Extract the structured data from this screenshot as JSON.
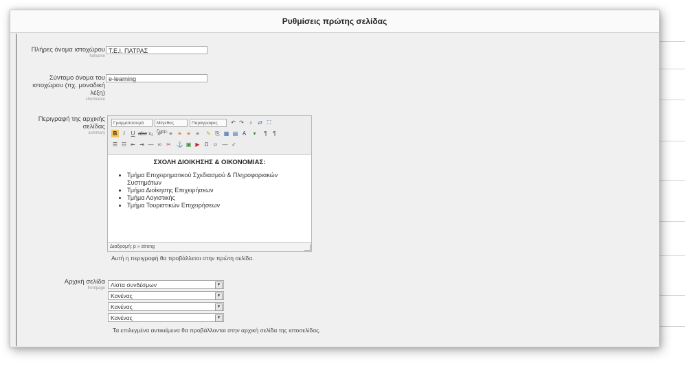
{
  "header": {
    "title": "Ρυθμίσεις πρώτης σελίδας"
  },
  "fullname": {
    "label": "Πλήρες όνομα ιστοχώρου",
    "sublabel": "fullname",
    "value": "Τ.Ε.Ι. ΠΑΤΡΑΣ"
  },
  "shortname": {
    "label_lines": [
      "Σύντομο όνομα του",
      "ιστοχώρου (πχ. μοναδική",
      "λέξη)"
    ],
    "sublabel": "shortname",
    "value": "e-learning"
  },
  "summary": {
    "label_lines": [
      "Περιγραφή της αρχικής",
      "σελίδας"
    ],
    "sublabel": "summary",
    "toolbar": {
      "font_select": "Γραμματοσειρά",
      "size_select": "Μέγεθος Γραμ.",
      "format_select": "Παράγραφος"
    },
    "heading": "ΣΧΟΛΗ ΔΙΟΙΚΗΣΗΣ & ΟΙΚΟΝΟΜΙΑΣ:",
    "items": [
      "Τμήμα Επιχειρηματικού Σχεδιασμού & Πληροφοριακών Συστημάτων",
      "Τμήμα Διοίκησης Επιχειρήσεων",
      "Τμήμα Λογιστικής",
      "Τμήμα Τουριστικών Επιχειρήσεων"
    ],
    "path": "Διαδρομή: p » strong",
    "help": "Αυτή η περιγραφή θα προβάλλεται στην πρώτη σελίδα."
  },
  "frontpage": {
    "label": "Αρχική σελίδα",
    "sublabel": "frontpage",
    "selects": [
      "Λίστα συνδέσμων",
      "Κανένας",
      "Κανένας",
      "Κανένας"
    ],
    "help": "Τα επιλεγμένα αντικείμενα θα προβάλλονται στην αρχική σελίδα της ιστοσελίδας."
  },
  "colors": {
    "panel_bg": "#f0f0f0",
    "header_bg": "#fafafa"
  }
}
